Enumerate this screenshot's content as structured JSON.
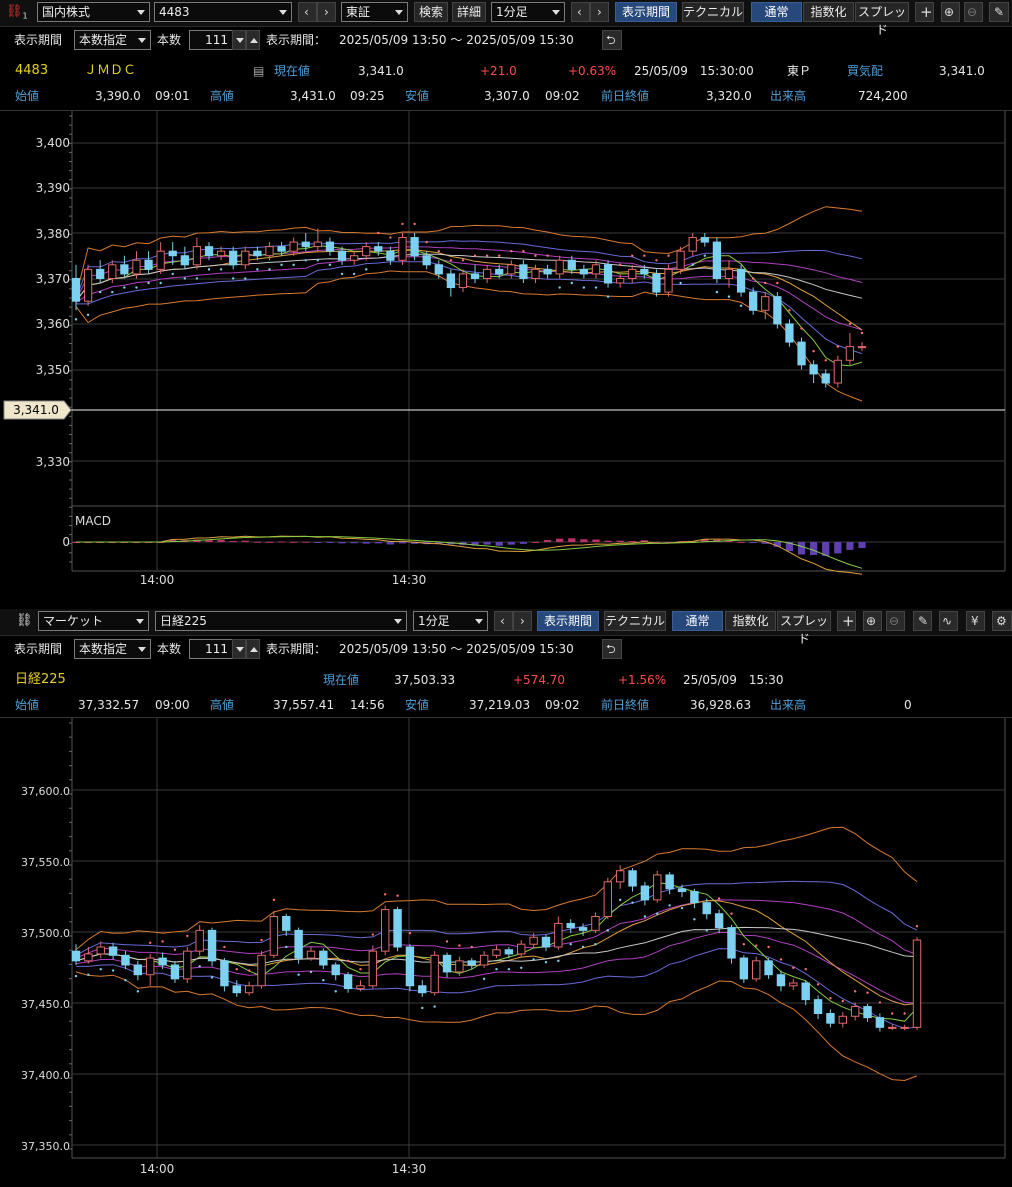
{
  "top": {
    "toolbar": {
      "market": "国内株式",
      "code": "4483",
      "exchange": "東証",
      "search": "検索",
      "detail": "詳細",
      "interval": "1分足",
      "period_btn": "表示期間",
      "technical_btn": "テクニカル",
      "mode_normal": "通常",
      "mode_index": "指数化",
      "mode_spread": "スプレッド"
    },
    "period_row": {
      "label": "表示期間",
      "mode": "本数指定",
      "count_label": "本数",
      "count": "111",
      "range_label": "表示期間：",
      "range": "2025/05/09 13:50 ～ 2025/05/09 15:30"
    },
    "quote": {
      "code": "4483",
      "name": "ＪＭＤＣ",
      "current_label": "現在値",
      "current": "3,341.0",
      "change": "+21.0",
      "change_pct": "+0.63%",
      "datetime": "25/05/09　15:30:00",
      "market": "東Ｐ",
      "quote_label": "買気配",
      "quote_value": "3,341.0",
      "open_label": "始値",
      "open": "3,390.0",
      "open_time": "09:01",
      "high_label": "高値",
      "high": "3,431.0",
      "high_time": "09:25",
      "low_label": "安値",
      "low": "3,307.0",
      "low_time": "09:02",
      "prev_label": "前日終値",
      "prev": "3,320.0",
      "volume_label": "出来高",
      "volume": "724,200"
    },
    "chart_data": {
      "type": "candlestick",
      "y_ticks": [
        "3,400",
        "3,390",
        "3,380",
        "3,370",
        "3,360",
        "3,350",
        "3,330"
      ],
      "ylim": [
        3325,
        3402
      ],
      "x_ticks": [
        "14:00",
        "14:30"
      ],
      "price_tag": "3,341.0",
      "sub_label": "MACD",
      "sub_tick": "0",
      "candles": [
        {
          "o": 3370,
          "c": 3365,
          "h": 3373,
          "l": 3363
        },
        {
          "o": 3365,
          "c": 3372,
          "h": 3373,
          "l": 3364
        },
        {
          "o": 3372,
          "c": 3370,
          "h": 3374,
          "l": 3369
        },
        {
          "o": 3370,
          "c": 3373,
          "h": 3374,
          "l": 3369
        },
        {
          "o": 3373,
          "c": 3371,
          "h": 3375,
          "l": 3370
        },
        {
          "o": 3371,
          "c": 3374,
          "h": 3376,
          "l": 3370
        },
        {
          "o": 3374,
          "c": 3372,
          "h": 3376,
          "l": 3371
        },
        {
          "o": 3372,
          "c": 3376,
          "h": 3378,
          "l": 3371
        },
        {
          "o": 3376,
          "c": 3375,
          "h": 3378,
          "l": 3373
        },
        {
          "o": 3375,
          "c": 3373,
          "h": 3377,
          "l": 3372
        },
        {
          "o": 3373,
          "c": 3377,
          "h": 3379,
          "l": 3372
        },
        {
          "o": 3377,
          "c": 3375,
          "h": 3378,
          "l": 3374
        },
        {
          "o": 3375,
          "c": 3376,
          "h": 3377,
          "l": 3374
        },
        {
          "o": 3376,
          "c": 3373,
          "h": 3377,
          "l": 3372
        },
        {
          "o": 3373,
          "c": 3376,
          "h": 3377,
          "l": 3372
        },
        {
          "o": 3376,
          "c": 3375,
          "h": 3377,
          "l": 3374
        },
        {
          "o": 3375,
          "c": 3377,
          "h": 3378,
          "l": 3374
        },
        {
          "o": 3377,
          "c": 3376,
          "h": 3378,
          "l": 3375
        },
        {
          "o": 3376,
          "c": 3378,
          "h": 3379,
          "l": 3375
        },
        {
          "o": 3378,
          "c": 3377,
          "h": 3380,
          "l": 3376
        },
        {
          "o": 3377,
          "c": 3378,
          "h": 3381,
          "l": 3376
        },
        {
          "o": 3378,
          "c": 3376,
          "h": 3379,
          "l": 3375
        },
        {
          "o": 3376,
          "c": 3374,
          "h": 3377,
          "l": 3373
        },
        {
          "o": 3374,
          "c": 3375,
          "h": 3376,
          "l": 3373
        },
        {
          "o": 3375,
          "c": 3377,
          "h": 3378,
          "l": 3374
        },
        {
          "o": 3377,
          "c": 3376,
          "h": 3378,
          "l": 3375
        },
        {
          "o": 3376,
          "c": 3374,
          "h": 3377,
          "l": 3373
        },
        {
          "o": 3374,
          "c": 3379,
          "h": 3380,
          "l": 3373
        },
        {
          "o": 3379,
          "c": 3375,
          "h": 3380,
          "l": 3374
        },
        {
          "o": 3375,
          "c": 3373,
          "h": 3376,
          "l": 3372
        },
        {
          "o": 3373,
          "c": 3371,
          "h": 3374,
          "l": 3370
        },
        {
          "o": 3371,
          "c": 3368,
          "h": 3372,
          "l": 3366
        },
        {
          "o": 3368,
          "c": 3371,
          "h": 3372,
          "l": 3367
        },
        {
          "o": 3371,
          "c": 3370,
          "h": 3373,
          "l": 3369
        },
        {
          "o": 3370,
          "c": 3372,
          "h": 3373,
          "l": 3369
        },
        {
          "o": 3372,
          "c": 3371,
          "h": 3373,
          "l": 3370
        },
        {
          "o": 3371,
          "c": 3373,
          "h": 3374,
          "l": 3370
        },
        {
          "o": 3373,
          "c": 3370,
          "h": 3374,
          "l": 3369
        },
        {
          "o": 3370,
          "c": 3372,
          "h": 3373,
          "l": 3369
        },
        {
          "o": 3372,
          "c": 3371,
          "h": 3373,
          "l": 3370
        },
        {
          "o": 3371,
          "c": 3374,
          "h": 3375,
          "l": 3370
        },
        {
          "o": 3374,
          "c": 3372,
          "h": 3375,
          "l": 3371
        },
        {
          "o": 3372,
          "c": 3371,
          "h": 3373,
          "l": 3370
        },
        {
          "o": 3371,
          "c": 3373,
          "h": 3374,
          "l": 3370
        },
        {
          "o": 3373,
          "c": 3369,
          "h": 3374,
          "l": 3368
        },
        {
          "o": 3369,
          "c": 3370,
          "h": 3371,
          "l": 3368
        },
        {
          "o": 3370,
          "c": 3372,
          "h": 3373,
          "l": 3369
        },
        {
          "o": 3372,
          "c": 3371,
          "h": 3373,
          "l": 3370
        },
        {
          "o": 3371,
          "c": 3367,
          "h": 3372,
          "l": 3366
        },
        {
          "o": 3367,
          "c": 3372,
          "h": 3373,
          "l": 3366
        },
        {
          "o": 3372,
          "c": 3376,
          "h": 3377,
          "l": 3371
        },
        {
          "o": 3376,
          "c": 3379,
          "h": 3380,
          "l": 3375
        },
        {
          "o": 3379,
          "c": 3378,
          "h": 3380,
          "l": 3377
        },
        {
          "o": 3378,
          "c": 3370,
          "h": 3379,
          "l": 3369
        },
        {
          "o": 3370,
          "c": 3372,
          "h": 3374,
          "l": 3368
        },
        {
          "o": 3372,
          "c": 3367,
          "h": 3373,
          "l": 3366
        },
        {
          "o": 3367,
          "c": 3363,
          "h": 3368,
          "l": 3362
        },
        {
          "o": 3363,
          "c": 3366,
          "h": 3367,
          "l": 3361
        },
        {
          "o": 3366,
          "c": 3360,
          "h": 3367,
          "l": 3359
        },
        {
          "o": 3360,
          "c": 3356,
          "h": 3361,
          "l": 3355
        },
        {
          "o": 3356,
          "c": 3351,
          "h": 3357,
          "l": 3350
        },
        {
          "o": 3351,
          "c": 3349,
          "h": 3352,
          "l": 3347
        },
        {
          "o": 3349,
          "c": 3347,
          "h": 3350,
          "l": 3346
        },
        {
          "o": 3347,
          "c": 3352,
          "h": 3353,
          "l": 3346
        },
        {
          "o": 3352,
          "c": 3355,
          "h": 3358,
          "l": 3351
        },
        {
          "o": 3355,
          "c": 3355,
          "h": 3356,
          "l": 3354
        }
      ]
    }
  },
  "bottom": {
    "toolbar": {
      "market": "マーケット",
      "code": "日経225",
      "interval": "1分足",
      "period_btn": "表示期間",
      "technical_btn": "テクニカル",
      "mode_normal": "通常",
      "mode_index": "指数化",
      "mode_spread": "スプレッド"
    },
    "period_row": {
      "label": "表示期間",
      "mode": "本数指定",
      "count_label": "本数",
      "count": "111",
      "range_label": "表示期間：",
      "range": "2025/05/09 13:50 ～ 2025/05/09 15:30"
    },
    "quote": {
      "name": "日経225",
      "current_label": "現在値",
      "current": "37,503.33",
      "change": "+574.70",
      "change_pct": "+1.56%",
      "datetime": "25/05/09　15:30",
      "open_label": "始値",
      "open": "37,332.57",
      "open_time": "09:00",
      "high_label": "高値",
      "high": "37,557.41",
      "high_time": "14:56",
      "low_label": "安値",
      "low": "37,219.03",
      "low_time": "09:02",
      "prev_label": "前日終値",
      "prev": "36,928.63",
      "volume_label": "出来高",
      "volume": "0"
    },
    "chart_data": {
      "type": "candlestick",
      "y_ticks": [
        "37,600.0",
        "37,550.0",
        "37,500.0",
        "37,450.0",
        "37,400.0",
        "37,350.0"
      ],
      "ylim": [
        37345,
        37625
      ],
      "x_ticks": [
        "14:00",
        "14:30"
      ],
      "candles": [
        {
          "o": 37495,
          "c": 37488,
          "h": 37500,
          "l": 37485
        },
        {
          "o": 37488,
          "c": 37493,
          "h": 37498,
          "l": 37486
        },
        {
          "o": 37493,
          "c": 37498,
          "h": 37502,
          "l": 37490
        },
        {
          "o": 37498,
          "c": 37492,
          "h": 37501,
          "l": 37489
        },
        {
          "o": 37492,
          "c": 37485,
          "h": 37495,
          "l": 37482
        },
        {
          "o": 37485,
          "c": 37478,
          "h": 37488,
          "l": 37474
        },
        {
          "o": 37478,
          "c": 37490,
          "h": 37493,
          "l": 37470
        },
        {
          "o": 37490,
          "c": 37485,
          "h": 37494,
          "l": 37482
        },
        {
          "o": 37485,
          "c": 37475,
          "h": 37488,
          "l": 37472
        },
        {
          "o": 37475,
          "c": 37495,
          "h": 37498,
          "l": 37472
        },
        {
          "o": 37495,
          "c": 37510,
          "h": 37514,
          "l": 37492
        },
        {
          "o": 37510,
          "c": 37488,
          "h": 37512,
          "l": 37484
        },
        {
          "o": 37488,
          "c": 37470,
          "h": 37490,
          "l": 37466
        },
        {
          "o": 37470,
          "c": 37465,
          "h": 37474,
          "l": 37462
        },
        {
          "o": 37465,
          "c": 37470,
          "h": 37473,
          "l": 37463
        },
        {
          "o": 37470,
          "c": 37492,
          "h": 37495,
          "l": 37468
        },
        {
          "o": 37492,
          "c": 37520,
          "h": 37524,
          "l": 37490
        },
        {
          "o": 37520,
          "c": 37510,
          "h": 37522,
          "l": 37506
        },
        {
          "o": 37510,
          "c": 37490,
          "h": 37512,
          "l": 37486
        },
        {
          "o": 37490,
          "c": 37495,
          "h": 37498,
          "l": 37488
        },
        {
          "o": 37495,
          "c": 37485,
          "h": 37497,
          "l": 37482
        },
        {
          "o": 37485,
          "c": 37478,
          "h": 37487,
          "l": 37474
        },
        {
          "o": 37478,
          "c": 37468,
          "h": 37480,
          "l": 37465
        },
        {
          "o": 37468,
          "c": 37470,
          "h": 37474,
          "l": 37466
        },
        {
          "o": 37470,
          "c": 37495,
          "h": 37499,
          "l": 37468
        },
        {
          "o": 37495,
          "c": 37525,
          "h": 37528,
          "l": 37492
        },
        {
          "o": 37525,
          "c": 37498,
          "h": 37527,
          "l": 37495
        },
        {
          "o": 37498,
          "c": 37470,
          "h": 37500,
          "l": 37466
        },
        {
          "o": 37470,
          "c": 37465,
          "h": 37474,
          "l": 37462
        },
        {
          "o": 37465,
          "c": 37492,
          "h": 37495,
          "l": 37463
        },
        {
          "o": 37492,
          "c": 37480,
          "h": 37494,
          "l": 37476
        },
        {
          "o": 37480,
          "c": 37488,
          "h": 37491,
          "l": 37477
        },
        {
          "o": 37488,
          "c": 37485,
          "h": 37490,
          "l": 37482
        },
        {
          "o": 37485,
          "c": 37492,
          "h": 37495,
          "l": 37483
        },
        {
          "o": 37492,
          "c": 37496,
          "h": 37499,
          "l": 37490
        },
        {
          "o": 37496,
          "c": 37493,
          "h": 37498,
          "l": 37490
        },
        {
          "o": 37493,
          "c": 37500,
          "h": 37503,
          "l": 37491
        },
        {
          "o": 37500,
          "c": 37505,
          "h": 37508,
          "l": 37497
        },
        {
          "o": 37505,
          "c": 37498,
          "h": 37507,
          "l": 37495
        },
        {
          "o": 37498,
          "c": 37515,
          "h": 37520,
          "l": 37496
        },
        {
          "o": 37515,
          "c": 37512,
          "h": 37518,
          "l": 37508
        },
        {
          "o": 37512,
          "c": 37510,
          "h": 37515,
          "l": 37506
        },
        {
          "o": 37510,
          "c": 37520,
          "h": 37523,
          "l": 37508
        },
        {
          "o": 37520,
          "c": 37545,
          "h": 37548,
          "l": 37518
        },
        {
          "o": 37545,
          "c": 37553,
          "h": 37557,
          "l": 37540
        },
        {
          "o": 37553,
          "c": 37542,
          "h": 37555,
          "l": 37538
        },
        {
          "o": 37542,
          "c": 37532,
          "h": 37545,
          "l": 37528
        },
        {
          "o": 37532,
          "c": 37550,
          "h": 37553,
          "l": 37530
        },
        {
          "o": 37550,
          "c": 37540,
          "h": 37552,
          "l": 37536
        },
        {
          "o": 37540,
          "c": 37538,
          "h": 37543,
          "l": 37534
        },
        {
          "o": 37538,
          "c": 37530,
          "h": 37540,
          "l": 37526
        },
        {
          "o": 37530,
          "c": 37522,
          "h": 37533,
          "l": 37518
        },
        {
          "o": 37522,
          "c": 37512,
          "h": 37525,
          "l": 37508
        },
        {
          "o": 37512,
          "c": 37490,
          "h": 37514,
          "l": 37486
        },
        {
          "o": 37490,
          "c": 37475,
          "h": 37492,
          "l": 37472
        },
        {
          "o": 37475,
          "c": 37488,
          "h": 37491,
          "l": 37473
        },
        {
          "o": 37488,
          "c": 37478,
          "h": 37490,
          "l": 37475
        },
        {
          "o": 37478,
          "c": 37470,
          "h": 37481,
          "l": 37466
        },
        {
          "o": 37470,
          "c": 37472,
          "h": 37475,
          "l": 37467
        },
        {
          "o": 37472,
          "c": 37460,
          "h": 37474,
          "l": 37456
        },
        {
          "o": 37460,
          "c": 37450,
          "h": 37463,
          "l": 37446
        },
        {
          "o": 37450,
          "c": 37443,
          "h": 37453,
          "l": 37440
        },
        {
          "o": 37443,
          "c": 37448,
          "h": 37451,
          "l": 37440
        },
        {
          "o": 37448,
          "c": 37455,
          "h": 37458,
          "l": 37445
        },
        {
          "o": 37455,
          "c": 37447,
          "h": 37457,
          "l": 37444
        },
        {
          "o": 37447,
          "c": 37440,
          "h": 37450,
          "l": 37437
        },
        {
          "o": 37440,
          "c": 37440,
          "h": 37442,
          "l": 37438
        },
        {
          "o": 37440,
          "c": 37440,
          "h": 37442,
          "l": 37438
        },
        {
          "o": 37440,
          "c": 37503,
          "h": 37505,
          "l": 37438
        }
      ]
    }
  },
  "colors": {
    "label": "#4f9fd6",
    "up": "#ff4b4b",
    "code": "#e8d020",
    "candle_down": "#7cd0f0",
    "candle_up": "#e06a6a",
    "grid": "#444444",
    "accent_blue": "#26487a"
  }
}
